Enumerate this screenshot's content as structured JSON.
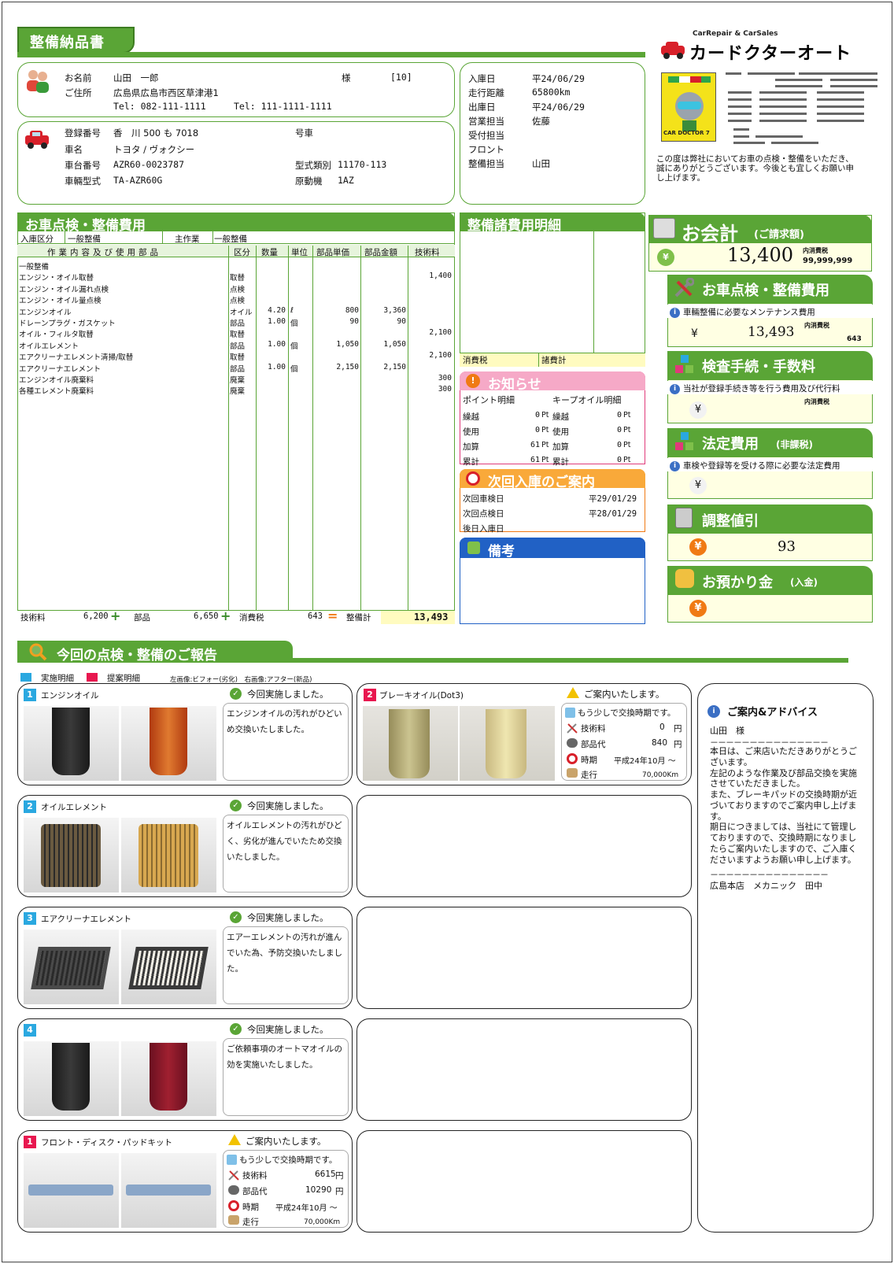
{
  "doc_title": "整備納品書",
  "brand": {
    "tagline": "CarRepair & CarSales",
    "name": "カードクターオート",
    "mascot_caption": "CAR DOCTOR 7"
  },
  "customer": {
    "name_label": "お名前",
    "name": "山田　一郎",
    "sama": "様",
    "code": "[10]",
    "addr_label": "ご住所",
    "address": "広島県広島市西区草津港1",
    "tel1": "Tel: 082-111-1111",
    "tel2": "Tel: 111-1111-1111"
  },
  "vehicle": {
    "reg_label": "登録番号",
    "reg_value": "香　川 500 も 7018",
    "gosha_label": "号車",
    "name_label": "車名",
    "name_value": "トヨタ / ヴォクシー",
    "chassis_label": "車台番号",
    "chassis_value": "AZR60-0023787",
    "type_label": "型式類別",
    "type_value": "11170-113",
    "model_label": "車輛型式",
    "model_value": "TA-AZR60G",
    "engine_label": "原動機",
    "engine_value": "1AZ"
  },
  "visit": {
    "rows": [
      {
        "label": "入庫日",
        "value": "平24/06/29"
      },
      {
        "label": "走行距離",
        "value": "65800km"
      },
      {
        "label": "出庫日",
        "value": "平24/06/29"
      },
      {
        "label": "営業担当",
        "value": "佐藤"
      },
      {
        "label": "受付担当",
        "value": ""
      },
      {
        "label": "フロント",
        "value": ""
      },
      {
        "label": "整備担当",
        "value": "山田"
      }
    ]
  },
  "message": "この度は弊社においてお車の点検・整備をいただき、誠にありがとうございます。今後とも宜しくお願い申し上げます。",
  "service": {
    "title": "お車点検・整備費用",
    "nyuko_label": "入庫区分",
    "nyuko_value": "一般整備",
    "shusagyo_label": "主作業",
    "shusagyo_value": "一般整備",
    "headers": [
      "作業内容及び使用部品",
      "区分",
      "数量",
      "単位",
      "部品単価",
      "部品金額",
      "技術料"
    ],
    "rows": [
      {
        "name": "一般整備",
        "kubun": "",
        "qty": "",
        "unit": "",
        "price": "",
        "amount": "",
        "tech": ""
      },
      {
        "name": "エンジン・オイル取替",
        "kubun": "取替",
        "qty": "",
        "unit": "",
        "price": "",
        "amount": "",
        "tech": "1,400"
      },
      {
        "name": "エンジン・オイル漏れ点検",
        "kubun": "点検",
        "qty": "",
        "unit": "",
        "price": "",
        "amount": "",
        "tech": ""
      },
      {
        "name": "エンジン・オイル量点検",
        "kubun": "点検",
        "qty": "",
        "unit": "",
        "price": "",
        "amount": "",
        "tech": ""
      },
      {
        "name": "エンジンオイル",
        "kubun": "オイル",
        "qty": "4.20",
        "unit": "ℓ",
        "price": "800",
        "amount": "3,360",
        "tech": ""
      },
      {
        "name": "ドレーンプラグ・ガスケット",
        "kubun": "部品",
        "qty": "1.00",
        "unit": "個",
        "price": "90",
        "amount": "90",
        "tech": ""
      },
      {
        "name": "オイル・フィルタ取替",
        "kubun": "取替",
        "qty": "",
        "unit": "",
        "price": "",
        "amount": "",
        "tech": "2,100"
      },
      {
        "name": "オイルエレメント",
        "kubun": "部品",
        "qty": "1.00",
        "unit": "個",
        "price": "1,050",
        "amount": "1,050",
        "tech": ""
      },
      {
        "name": "エアクリーナエレメント清掃/取替",
        "kubun": "取替",
        "qty": "",
        "unit": "",
        "price": "",
        "amount": "",
        "tech": "2,100"
      },
      {
        "name": "エアクリーナエレメント",
        "kubun": "部品",
        "qty": "1.00",
        "unit": "個",
        "price": "2,150",
        "amount": "2,150",
        "tech": ""
      },
      {
        "name": "エンジンオイル廃棄料",
        "kubun": "廃棄",
        "qty": "",
        "unit": "",
        "price": "",
        "amount": "",
        "tech": "300"
      },
      {
        "name": "各種エレメント廃棄料",
        "kubun": "廃棄",
        "qty": "",
        "unit": "",
        "price": "",
        "amount": "",
        "tech": "300"
      }
    ],
    "footer": {
      "tech_label": "技術料",
      "tech_value": "6,200",
      "plus": "+",
      "parts_label": "部品",
      "parts_value": "6,650",
      "tax_label": "消費税",
      "tax_value": "643",
      "eq": "=",
      "total_label": "整備計",
      "total_value": "13,493"
    }
  },
  "misc_costs": {
    "title": "整備諸費用明細",
    "tax_label": "消費税",
    "total_label": "諸費計"
  },
  "notice": {
    "title": "お知らせ",
    "point_title": "ポイント明細",
    "oil_title": "キープオイル明細",
    "rows": [
      {
        "l1": "繰越",
        "v1": "0",
        "u1": "Pt",
        "l2": "繰越",
        "v2": "0",
        "u2": "Pt"
      },
      {
        "l1": "使用",
        "v1": "0",
        "u1": "Pt",
        "l2": "使用",
        "v2": "0",
        "u2": "Pt"
      },
      {
        "l1": "加算",
        "v1": "61",
        "u1": "Pt",
        "l2": "加算",
        "v2": "0",
        "u2": "Pt"
      },
      {
        "l1": "累計",
        "v1": "61",
        "u1": "Pt",
        "l2": "累計",
        "v2": "0",
        "u2": "Pt"
      }
    ]
  },
  "next_visit": {
    "title": "次回入庫のご案内",
    "rows": [
      {
        "label": "次回車検日",
        "value": "平29/01/29"
      },
      {
        "label": "次回点検日",
        "value": "平28/01/29"
      },
      {
        "label": "後日入庫日",
        "value": ""
      }
    ]
  },
  "remarks": {
    "title": "備考"
  },
  "billing": {
    "title": "お会計",
    "sub": "(ご請求額)",
    "amount": "13,400",
    "tax_note": "内消費税",
    "tax_value": "99,999,999",
    "sections": [
      {
        "title": "お車点検・整備費用",
        "desc": "車輛整備に必要なメンテナンス費用",
        "amount": "13,493",
        "tax_note": "内消費税",
        "tax_value": "643"
      },
      {
        "title": "検査手続・手数料",
        "desc": "当社が登録手続き等を行う費用及び代行料",
        "amount": "",
        "tax_note": "内消費税",
        "tax_value": ""
      },
      {
        "title": "法定費用",
        "sub": "(非課税)",
        "desc": "車検や登録等を受ける際に必要な法定費用",
        "amount": "",
        "tax_note": "",
        "tax_value": ""
      }
    ],
    "discount": {
      "title": "調整値引",
      "amount": "93"
    },
    "deposit": {
      "title": "お預かり金",
      "sub": "(入金)",
      "amount": ""
    },
    "yen": "¥"
  },
  "report": {
    "title": "今回の点検・整備のご報告",
    "legend_done": "実施明細",
    "legend_prop": "提案明細",
    "legend_note": "左画像:ビフォー(劣化)　右画像:アフター(新品)",
    "done_label": "今回実施しました。",
    "suggest_label": "ご案内いたします。",
    "soon_label": "もう少しで交換時期です。",
    "tech_label": "技術料",
    "parts_label": "部品代",
    "time_label": "時期",
    "run_label": "走行",
    "items": [
      {
        "num": "1",
        "kind": "done",
        "name": "エンジンオイル",
        "text": "エンジンオイルの汚れがひどいめ交換いたしました。"
      },
      {
        "num": "2",
        "kind": "done",
        "name": "オイルエレメント",
        "text": "オイルエレメントの汚れがひどく、劣化が進んでいたため交換いたしました。"
      },
      {
        "num": "3",
        "kind": "done",
        "name": "エアクリーナエレメント",
        "text": "エアーエレメントの汚れが進んでいた為、予防交換いたしました。"
      },
      {
        "num": "4",
        "kind": "done",
        "name": "",
        "text": "ご依頼事項のオートマオイルの効を実施いたしました。"
      },
      {
        "num": "1",
        "kind": "prop",
        "name": "フロント・ディスク・パッドキット",
        "tech": "6615",
        "parts": "10290",
        "time": "平成24年10月 ～",
        "run": "70,000Km"
      }
    ],
    "right_item": {
      "num": "2",
      "name": "ブレーキオイル(Dot3)",
      "tech": "0",
      "parts": "840",
      "time": "平成24年10月 ～",
      "run": "70,000Km"
    },
    "yen_unit": "円"
  },
  "advice": {
    "title": "ご案内&アドバイス",
    "to": "山田　様",
    "divider": "－－－－－－－－－－－－－－－",
    "lines": [
      "本日は、ご来店いただきありがとうございます。",
      "左記のような作業及び部品交換を実施させていただきました。",
      "また、ブレーキパッドの交換時期が近づいておりますのでご案内申し上げます。",
      "期日につきましては、当社にて管理しておりますので、交換時期になりましたらご案内いたしますので、ご入庫くださいますようお願い申し上げます。"
    ],
    "sign": "広島本店　メカニック　田中"
  },
  "colors": {
    "green": "#5aa536",
    "pink": "#e03a7a",
    "orange": "#f07a14",
    "blue": "#2161c5",
    "yellow_bg": "#ffffe3"
  }
}
